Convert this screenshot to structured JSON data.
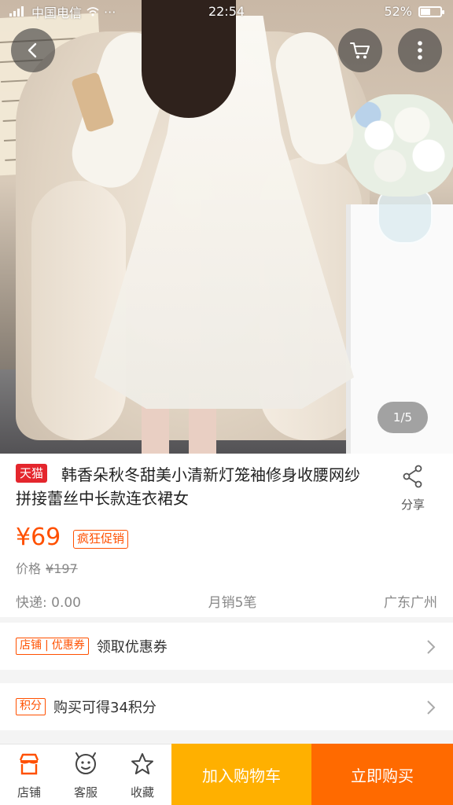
{
  "status_bar": {
    "carrier": "中国电信",
    "dots": "···",
    "time": "22:54",
    "battery": "52%",
    "battery_level": 0.52
  },
  "gallery": {
    "counter": "1/5"
  },
  "product": {
    "badge": "天猫",
    "title": "韩香朵秋冬甜美小清新灯笼袖修身收腰网纱拼接蕾丝中长款连衣裙女",
    "share_label": "分享",
    "price": "¥69",
    "promo_tag": "疯狂促销",
    "original_price_label": "价格",
    "original_price": "¥197",
    "shipping": "快递: 0.00",
    "monthly_sales": "月销5笔",
    "location": "广东广州"
  },
  "coupon_row": {
    "tag_left": "店铺",
    "tag_right": "优惠券",
    "text": "领取优惠券"
  },
  "points_row": {
    "tag": "积分",
    "text": "购买可得34积分"
  },
  "bottom_bar": {
    "shop_label": "店铺",
    "service_label": "客服",
    "favorite_label": "收藏",
    "add_to_cart": "加入购物车",
    "buy_now": "立即购买"
  },
  "colors": {
    "accent": "#ff5000",
    "cart_button": "#ffb000",
    "buy_button": "#ff6a00",
    "tmall_red": "#e4262d"
  },
  "icons": [
    "back-icon",
    "cart-icon",
    "more-icon",
    "share-icon",
    "chevron-right-icon",
    "shop-icon",
    "service-icon",
    "star-icon"
  ]
}
